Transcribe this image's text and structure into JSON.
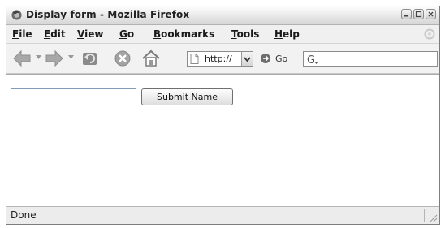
{
  "window": {
    "title": "Display form - Mozilla Firefox"
  },
  "menubar": {
    "items": [
      {
        "first": "F",
        "rest": "ile"
      },
      {
        "first": "E",
        "rest": "dit"
      },
      {
        "first": "V",
        "rest": "iew"
      },
      {
        "first": "G",
        "rest": "o"
      },
      {
        "first": "B",
        "rest": "ookmarks"
      },
      {
        "first": "T",
        "rest": "ools"
      },
      {
        "first": "H",
        "rest": "elp"
      }
    ]
  },
  "toolbar": {
    "url_value": "http://",
    "go_label": "Go"
  },
  "form": {
    "name_value": "",
    "submit_label": "Submit Name"
  },
  "status": {
    "text": "Done"
  },
  "icons": {
    "app": "firefox-icon",
    "back": "back-arrow-icon",
    "forward": "forward-arrow-icon",
    "reload": "reload-icon",
    "stop": "stop-icon",
    "home": "home-icon",
    "go": "go-arrow-icon",
    "search_engine": "google-icon"
  }
}
